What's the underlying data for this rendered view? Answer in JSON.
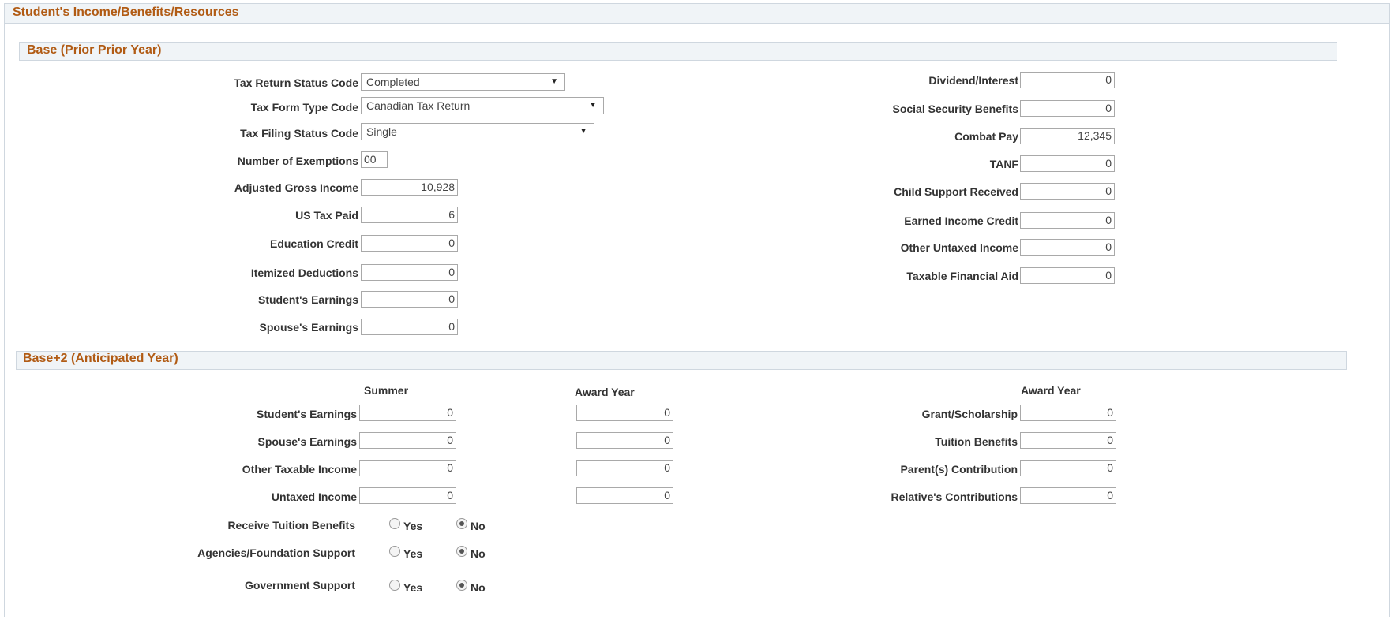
{
  "page": {
    "title": "Student's Income/Benefits/Resources"
  },
  "base": {
    "title": "Base (Prior Prior Year)",
    "tax_return_status": {
      "label": "Tax Return Status Code",
      "value": "Completed"
    },
    "tax_form_type": {
      "label": "Tax Form Type Code",
      "value": "Canadian Tax Return"
    },
    "tax_filing_status": {
      "label": "Tax Filing Status Code",
      "value": "Single"
    },
    "exemptions": {
      "label": "Number of Exemptions",
      "value": "00"
    },
    "left_fields": [
      {
        "label": "Adjusted Gross Income",
        "value": "10,928"
      },
      {
        "label": "US Tax Paid",
        "value": "6"
      },
      {
        "label": "Education Credit",
        "value": "0"
      },
      {
        "label": "Itemized Deductions",
        "value": "0"
      },
      {
        "label": "Student's Earnings",
        "value": "0"
      },
      {
        "label": "Spouse's Earnings",
        "value": "0"
      }
    ],
    "right_fields": [
      {
        "label": "Dividend/Interest",
        "value": "0"
      },
      {
        "label": "Social Security Benefits",
        "value": "0"
      },
      {
        "label": "Combat Pay",
        "value": "12,345"
      },
      {
        "label": "TANF",
        "value": "0"
      },
      {
        "label": "Child Support Received",
        "value": "0"
      },
      {
        "label": "Earned Income Credit",
        "value": "0"
      },
      {
        "label": "Other Untaxed Income",
        "value": "0"
      },
      {
        "label": "Taxable Financial Aid",
        "value": "0"
      }
    ]
  },
  "anticipated": {
    "title": "Base+2 (Anticipated Year)",
    "col_summer": "Summer",
    "col_award_year": "Award Year",
    "col_award_year_right": "Award Year",
    "rows": [
      {
        "label": "Student's Earnings",
        "summer": "0",
        "award": "0"
      },
      {
        "label": "Spouse's Earnings",
        "summer": "0",
        "award": "0"
      },
      {
        "label": "Other Taxable Income",
        "summer": "0",
        "award": "0"
      },
      {
        "label": "Untaxed Income",
        "summer": "0",
        "award": "0"
      }
    ],
    "right_rows": [
      {
        "label": "Grant/Scholarship",
        "value": "0"
      },
      {
        "label": "Tuition Benefits",
        "value": "0"
      },
      {
        "label": "Parent(s) Contribution",
        "value": "0"
      },
      {
        "label": "Relative's Contributions",
        "value": "0"
      }
    ],
    "radios": [
      {
        "label": "Receive Tuition Benefits",
        "yes": "Yes",
        "no": "No",
        "selected": "No"
      },
      {
        "label": "Agencies/Foundation Support",
        "yes": "Yes",
        "no": "No",
        "selected": "No"
      },
      {
        "label": "Government Support",
        "yes": "Yes",
        "no": "No",
        "selected": "No"
      }
    ]
  },
  "colors": {
    "accent": "#b15b14",
    "header_bg": "#f0f4f7",
    "border": "#cfd7df"
  }
}
